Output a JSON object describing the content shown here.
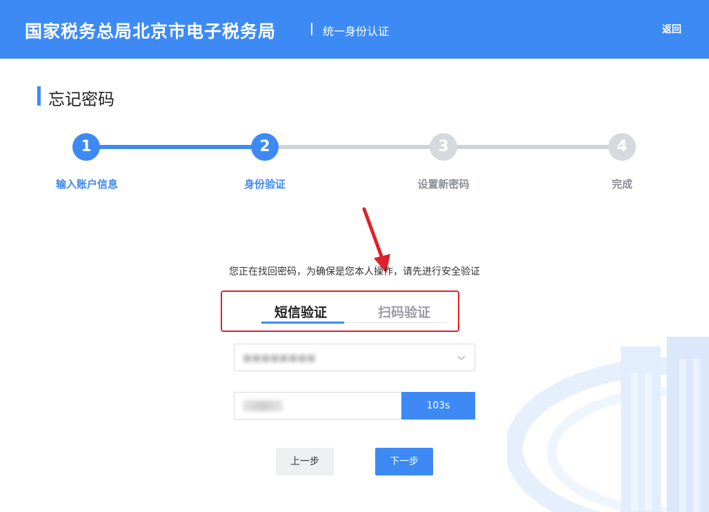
{
  "header": {
    "brand": "国家税务总局北京市电子税务局",
    "subtitle": "统一身份认证",
    "back_label": "返回"
  },
  "page": {
    "title": "忘记密码"
  },
  "steps": [
    {
      "num": "1",
      "label": "输入账户信息",
      "state": "done"
    },
    {
      "num": "2",
      "label": "身份验证",
      "state": "current"
    },
    {
      "num": "3",
      "label": "设置新密码",
      "state": "todo"
    },
    {
      "num": "4",
      "label": "完成",
      "state": "todo"
    }
  ],
  "instruction": "您正在找回密码，为确保是您本人操作，请先进行安全验证",
  "tabs": {
    "sms": "短信验证",
    "qr": "扫码验证",
    "selected": "sms"
  },
  "phone_select": {
    "value": "■■■■■■■■"
  },
  "code": {
    "value": "",
    "countdown": "103s"
  },
  "buttons": {
    "prev": "上一步",
    "next": "下一步"
  },
  "colors": {
    "primary": "#3d8af5",
    "annotation": "#e0202a",
    "inactive": "#cfd3d8"
  },
  "icons": {
    "dropdown": "chevron-down-icon",
    "annotation_arrow": "arrow-icon"
  }
}
